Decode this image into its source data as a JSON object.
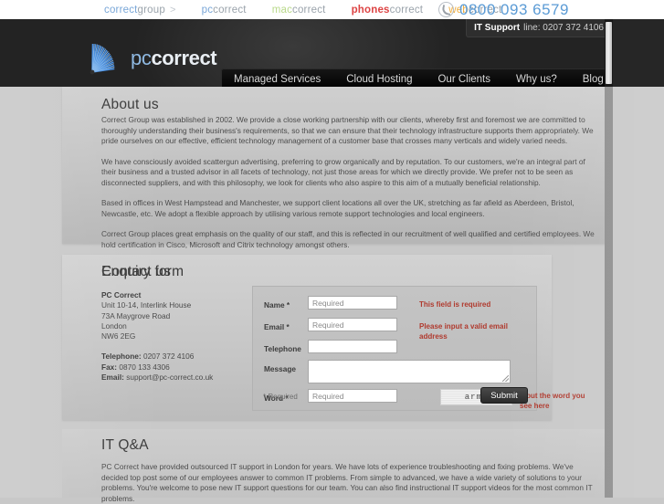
{
  "topnav": {
    "items": [
      {
        "name": "correctgroup",
        "part1": "correct",
        "part2": "group",
        "arrow": ">"
      },
      {
        "name": "pccorrect",
        "part1": "pc",
        "part2": "correct",
        "arrow": ""
      },
      {
        "name": "maccorrect",
        "part1": "mac",
        "part2": "correct",
        "arrow": ""
      },
      {
        "name": "phonescorrect",
        "part1": "phones",
        "part2": "correct",
        "arrow": ""
      },
      {
        "name": "webcorrect",
        "part1": "web",
        "part2": "correct",
        "arrow": ""
      }
    ],
    "phone": "0800 093 6579",
    "it_support_label": "IT Support",
    "it_support_line": "line: 0207 372 4106"
  },
  "brand": {
    "part1": "pc",
    "part2": "correct"
  },
  "mainnav": {
    "items": [
      "Managed Services",
      "Cloud Hosting",
      "Our Clients",
      "Why us?",
      "Blog"
    ]
  },
  "about": {
    "title": "About us",
    "paragraphs": [
      "Correct Group was established in 2002. We provide a close working partnership with our clients, whereby first and foremost we are committed to thoroughly understanding their business's requirements, so that we can ensure that their technology infrastructure supports them appropriately. We pride ourselves on our effective, efficient technology management of a customer base that crosses many verticals and widely varied needs.",
      "We have consciously avoided scattergun advertising, preferring to grow organically and by reputation. To our customers, we're an integral part of their business and a trusted advisor in all facets of technology, not just those areas for which we directly provide. We prefer not to be seen as disconnected suppliers, and with this philosophy, we look for clients who also aspire to this aim of a mutually beneficial relationship.",
      "Based in offices in West Hampstead and Manchester, we support client locations all over the UK, stretching as far afield as Aberdeen, Bristol, Newcastle, etc. We adopt a flexible approach by utilising various remote support technologies and local engineers.",
      "Correct Group places great emphasis on the quality of our staff, and this is reflected in our recruitment of well qualified and certified employees. We hold certification in Cisco, Microsoft and Citrix technology amongst others."
    ]
  },
  "contact": {
    "title": "Contact us",
    "company": "PC Correct",
    "address_lines": [
      "Unit 10-14, Interlink House",
      "73A Maygrove Road",
      "London",
      "NW6 2EG"
    ],
    "telephone_label": "Telephone:",
    "telephone_value": "0207 372 4106",
    "fax_label": "Fax:",
    "fax_value": "0870 133 4306",
    "email_label": "Email:",
    "email_value": "support@pc-correct.co.uk"
  },
  "enquiry": {
    "title": "Enquiry form",
    "fields": [
      {
        "label": "Name *",
        "placeholder": "Required",
        "error": "This field is required"
      },
      {
        "label": "Email *",
        "placeholder": "Required",
        "error": "Please input a valid email address"
      },
      {
        "label": "Telephone",
        "placeholder": "",
        "error": ""
      },
      {
        "label": "Message",
        "placeholder": "",
        "error": ""
      },
      {
        "label": "Word *",
        "placeholder": "Required",
        "error": "Input the word you see here"
      }
    ],
    "captcha_text": "army",
    "required_note": "* Required",
    "submit_label": "Submit"
  },
  "qa": {
    "title": "IT Q&A",
    "paragraph": "PC Correct have provided outsourced IT support in London for years. We have lots of experience troubleshooting and fixing problems. We've decided top post some of our employees answer to common IT problems. From simple to advanced, we have a wide variety of solutions to your problems. You're welcome to pose new IT support questions for our team. You can also find instructional IT support videos for the most common IT problems."
  },
  "colors": {
    "accent_blue": "#5b9bd5",
    "error_red": "#b03a2e",
    "header_dark": "#232323",
    "page_bg": "#c9c9c9"
  }
}
